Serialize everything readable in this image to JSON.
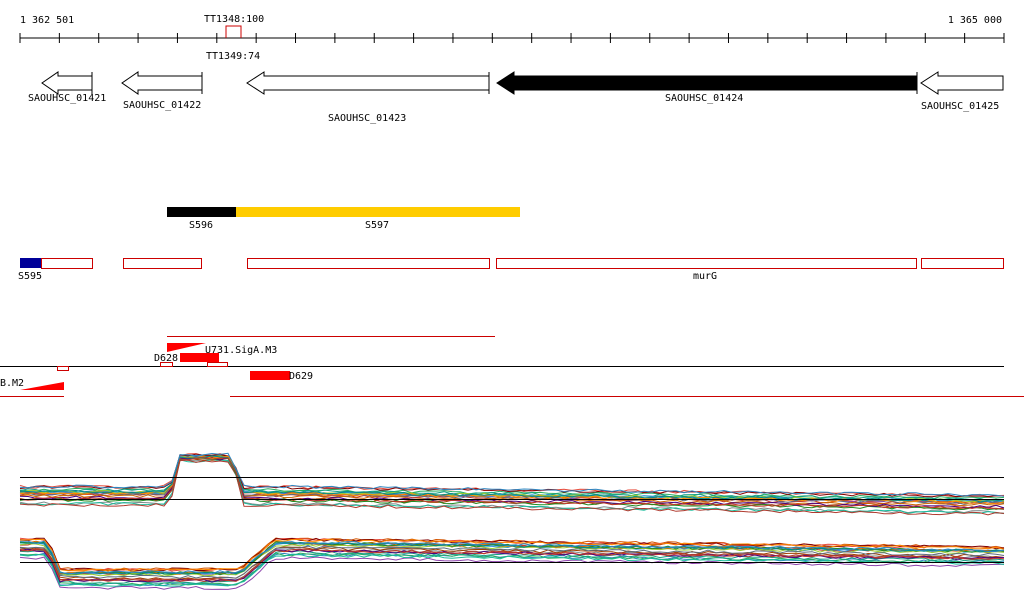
{
  "ruler": {
    "start_label": "1 362 501",
    "end_label": "1 365 000"
  },
  "terminators": {
    "top_label": "TT1348:100",
    "bottom_label": "TT1349:74"
  },
  "genes": [
    {
      "id": "SAOUHSC_01421",
      "filled": false
    },
    {
      "id": "SAOUHSC_01422",
      "filled": false
    },
    {
      "id": "SAOUHSC_01423",
      "filled": false
    },
    {
      "id": "SAOUHSC_01424",
      "filled": true
    },
    {
      "id": "SAOUHSC_01425",
      "filled": false
    }
  ],
  "srna": [
    {
      "id": "S596",
      "color": "#000000"
    },
    {
      "id": "S597",
      "color": "#ffcc00"
    }
  ],
  "s595": {
    "id": "S595",
    "color": "#000099"
  },
  "operon_label": "murG",
  "tss": {
    "d628": "D628",
    "sig": "U731.SigA.M3",
    "d629": "D629",
    "left": "B.M2"
  },
  "colors": {
    "outline_red": "#cc0000",
    "bright_red": "#ff0000"
  }
}
